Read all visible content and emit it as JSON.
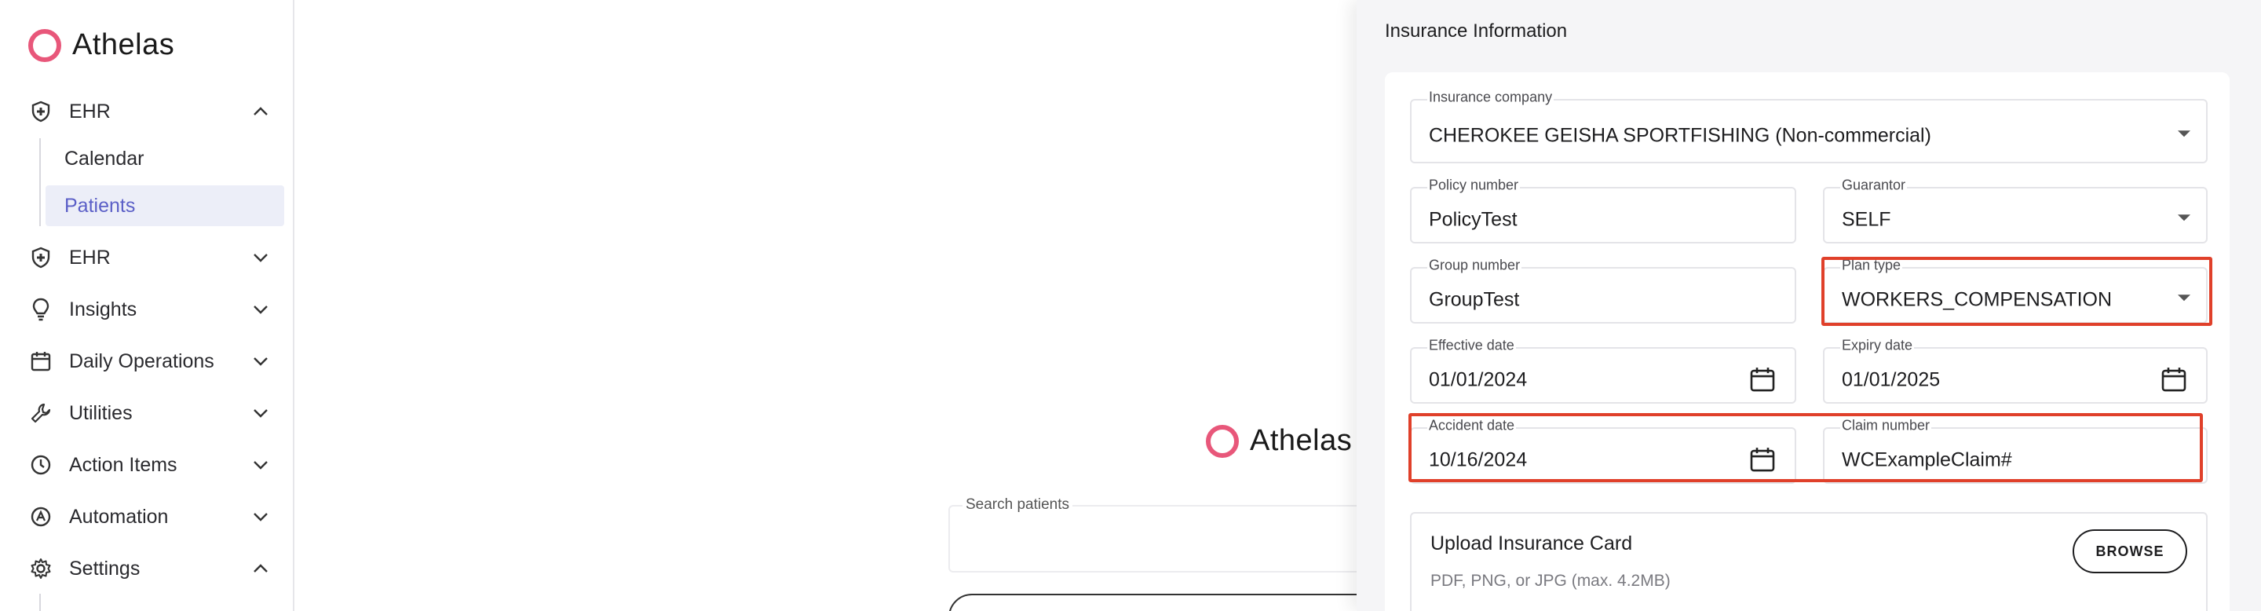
{
  "app": {
    "brand": "Athelas"
  },
  "sidebar": {
    "items": [
      {
        "label": "EHR",
        "icon": "shield-plus-icon",
        "expanded": true,
        "children": [
          {
            "label": "Calendar",
            "active": false
          },
          {
            "label": "Patients",
            "active": true
          }
        ]
      },
      {
        "label": "EHR",
        "icon": "shield-plus-icon",
        "expanded": false
      },
      {
        "label": "Insights",
        "icon": "lightbulb-icon",
        "expanded": false
      },
      {
        "label": "Daily Operations",
        "icon": "calendar-icon",
        "expanded": false
      },
      {
        "label": "Utilities",
        "icon": "wrench-icon",
        "expanded": false
      },
      {
        "label": "Action Items",
        "icon": "clock-icon",
        "expanded": false
      },
      {
        "label": "Automation",
        "icon": "automation-icon",
        "expanded": false
      },
      {
        "label": "Settings",
        "icon": "gear-icon",
        "expanded": true
      }
    ]
  },
  "background": {
    "brand": "Athelas",
    "search_label": "Search patients"
  },
  "drawer": {
    "title": "Insurance Information",
    "fields": {
      "insurance_company": {
        "label": "Insurance company",
        "value": "CHEROKEE GEISHA SPORTFISHING (Non-commercial)"
      },
      "policy_number": {
        "label": "Policy number",
        "value": "PolicyTest"
      },
      "guarantor": {
        "label": "Guarantor",
        "value": "SELF"
      },
      "group_number": {
        "label": "Group number",
        "value": "GroupTest"
      },
      "plan_type": {
        "label": "Plan type",
        "value": "WORKERS_COMPENSATION"
      },
      "effective_date": {
        "label": "Effective date",
        "value": "01/01/2024"
      },
      "expiry_date": {
        "label": "Expiry date",
        "value": "01/01/2025"
      },
      "accident_date": {
        "label": "Accident date",
        "value": "10/16/2024"
      },
      "claim_number": {
        "label": "Claim number",
        "value": "WCExampleClaim#"
      }
    },
    "upload": {
      "title": "Upload Insurance Card",
      "hint": "PDF, PNG, or JPG (max. 4.2MB)",
      "browse_label": "BROWSE"
    }
  },
  "colors": {
    "brand": "#e8577a",
    "accent": "#5b5fc7",
    "highlight": "#e0402a"
  }
}
